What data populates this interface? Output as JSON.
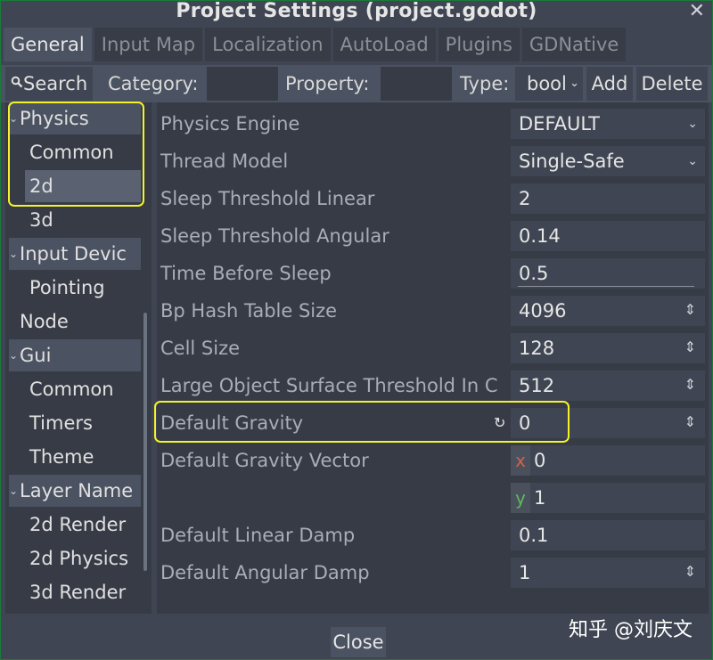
{
  "window": {
    "title": "Project Settings (project.godot)",
    "close_glyph": "✕"
  },
  "tabs": [
    {
      "label": "General",
      "active": true
    },
    {
      "label": "Input Map"
    },
    {
      "label": "Localization"
    },
    {
      "label": "AutoLoad"
    },
    {
      "label": "Plugins"
    },
    {
      "label": "GDNative"
    }
  ],
  "toolbar": {
    "search_label": "Search",
    "category_label": "Category:",
    "category_value": "",
    "property_label": "Property:",
    "property_value": "",
    "type_label": "Type:",
    "type_value": "bool",
    "add_label": "Add",
    "delete_label": "Delete"
  },
  "tree": [
    {
      "label": "Physics",
      "chevron": "⌄",
      "level": 0
    },
    {
      "label": "Common",
      "level": 1
    },
    {
      "label": "2d",
      "level": 1,
      "selected": true
    },
    {
      "label": "3d",
      "level": 1
    },
    {
      "label": "Input Devic",
      "chevron": "⌄",
      "level": 0
    },
    {
      "label": "Pointing",
      "level": 1
    },
    {
      "label": "Node",
      "level": 0
    },
    {
      "label": "Gui",
      "chevron": "⌄",
      "level": 0
    },
    {
      "label": "Common",
      "level": 1
    },
    {
      "label": "Timers",
      "level": 1
    },
    {
      "label": "Theme",
      "level": 1
    },
    {
      "label": "Layer Name",
      "chevron": "⌄",
      "level": 0
    },
    {
      "label": "2d Render",
      "level": 1
    },
    {
      "label": "2d Physics",
      "level": 1
    },
    {
      "label": "3d Render",
      "level": 1
    }
  ],
  "properties": [
    {
      "label": "Physics Engine",
      "value": "DEFAULT",
      "kind": "dropdown"
    },
    {
      "label": "Thread Model",
      "value": "Single-Safe",
      "kind": "dropdown"
    },
    {
      "label": "Sleep Threshold Linear",
      "value": "2",
      "kind": "text"
    },
    {
      "label": "Sleep Threshold Angular",
      "value": "0.14",
      "kind": "text"
    },
    {
      "label": "Time Before Sleep",
      "value": "0.5",
      "kind": "slider"
    },
    {
      "label": "Bp Hash Table Size",
      "value": "4096",
      "kind": "spin"
    },
    {
      "label": "Cell Size",
      "value": "128",
      "kind": "spin"
    },
    {
      "label": "Large Object Surface Threshold In C",
      "value": "512",
      "kind": "spin"
    },
    {
      "label": "Default Gravity",
      "value": "0",
      "kind": "spin",
      "revert": "↻"
    },
    {
      "label": "Default Gravity Vector",
      "x_label": "x",
      "x_value": "0",
      "y_label": "y",
      "y_value": "1",
      "kind": "vector"
    },
    {
      "label": "Default Linear Damp",
      "value": "0.1",
      "kind": "text"
    },
    {
      "label": "Default Angular Damp",
      "value": "1",
      "kind": "spin"
    }
  ],
  "footer": {
    "close_label": "Close",
    "watermark": "知乎 @刘庆文"
  },
  "colors": {
    "highlight": "#f5f22a",
    "axis_x": "#d0634a",
    "axis_y": "#5fb85f"
  }
}
